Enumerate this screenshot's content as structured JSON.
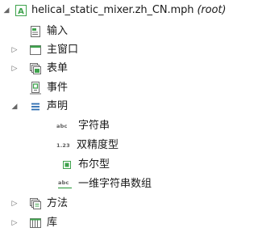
{
  "tree": {
    "root": {
      "file": "helical_static_mixer.zh_CN.mph",
      "tag": "(root)"
    },
    "items": [
      {
        "label": "输入"
      },
      {
        "label": "主窗口"
      },
      {
        "label": "表单"
      },
      {
        "label": "事件"
      },
      {
        "label": "声明",
        "children": [
          {
            "badge": "abc",
            "label": "字符串"
          },
          {
            "badge": "1.23",
            "label": "双精度型"
          },
          {
            "badge": "☑",
            "label": "布尔型"
          },
          {
            "badge": "abc",
            "label": "一维字符串数组"
          }
        ]
      },
      {
        "label": "方法"
      },
      {
        "label": "库"
      }
    ]
  },
  "colors": {
    "accent": "#0078d4",
    "icon_gray": "#6d6d6d",
    "icon_green": "#3fa34d"
  }
}
